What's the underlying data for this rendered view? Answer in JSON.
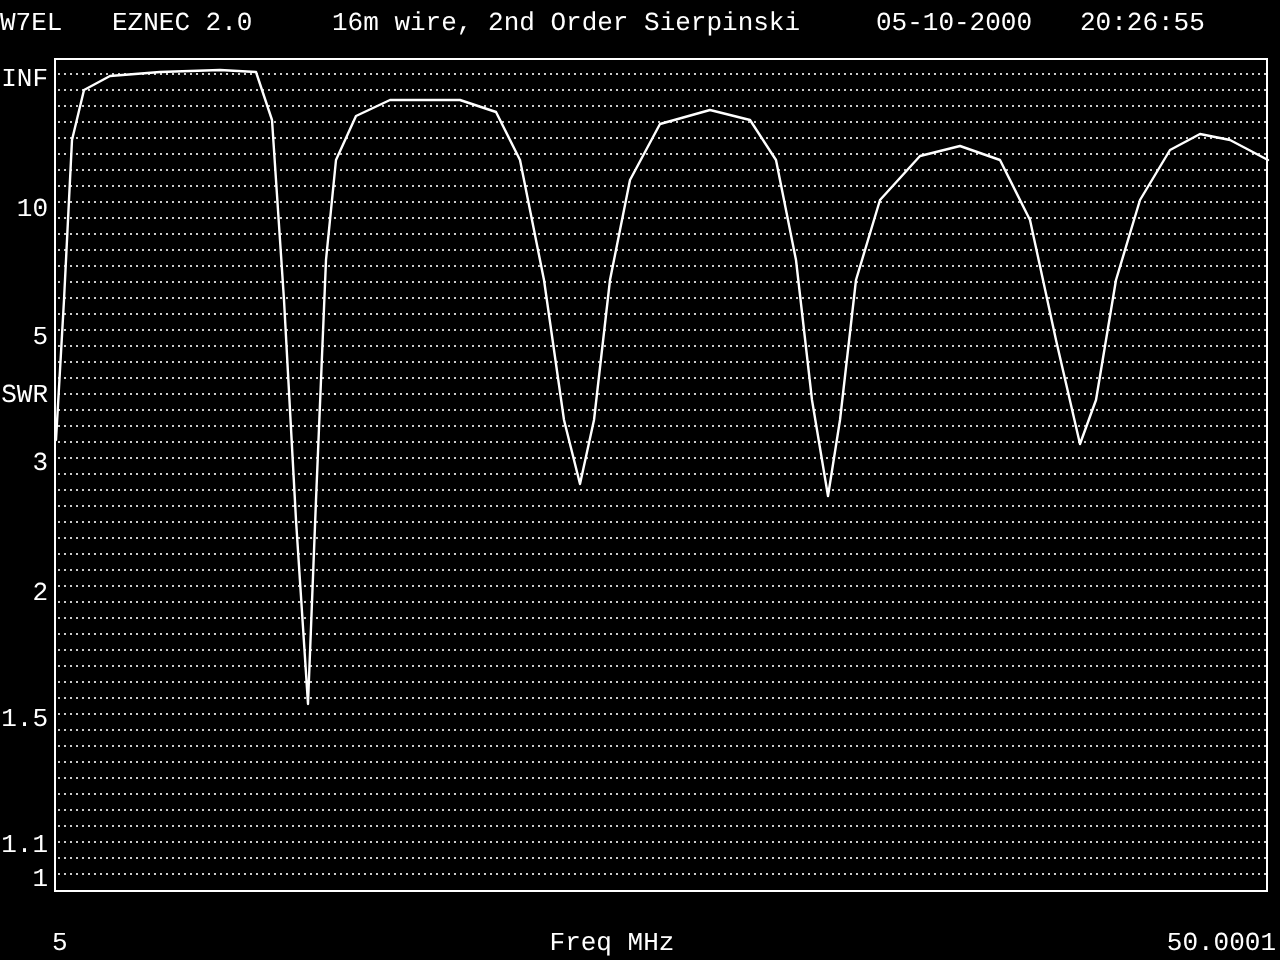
{
  "header": {
    "author": "W7EL",
    "program": "EZNEC 2.0",
    "title": "16m wire, 2nd Order Sierpinski",
    "date": "05-10-2000",
    "time": "20:26:55"
  },
  "plot": {
    "y_title": "SWR",
    "x_title": "Freq MHz",
    "y_labels": [
      "INF",
      "10",
      "5",
      "3",
      "2",
      "1.5",
      "1.1",
      "1"
    ],
    "x_labels": [
      "5",
      "50.0001"
    ]
  }
}
